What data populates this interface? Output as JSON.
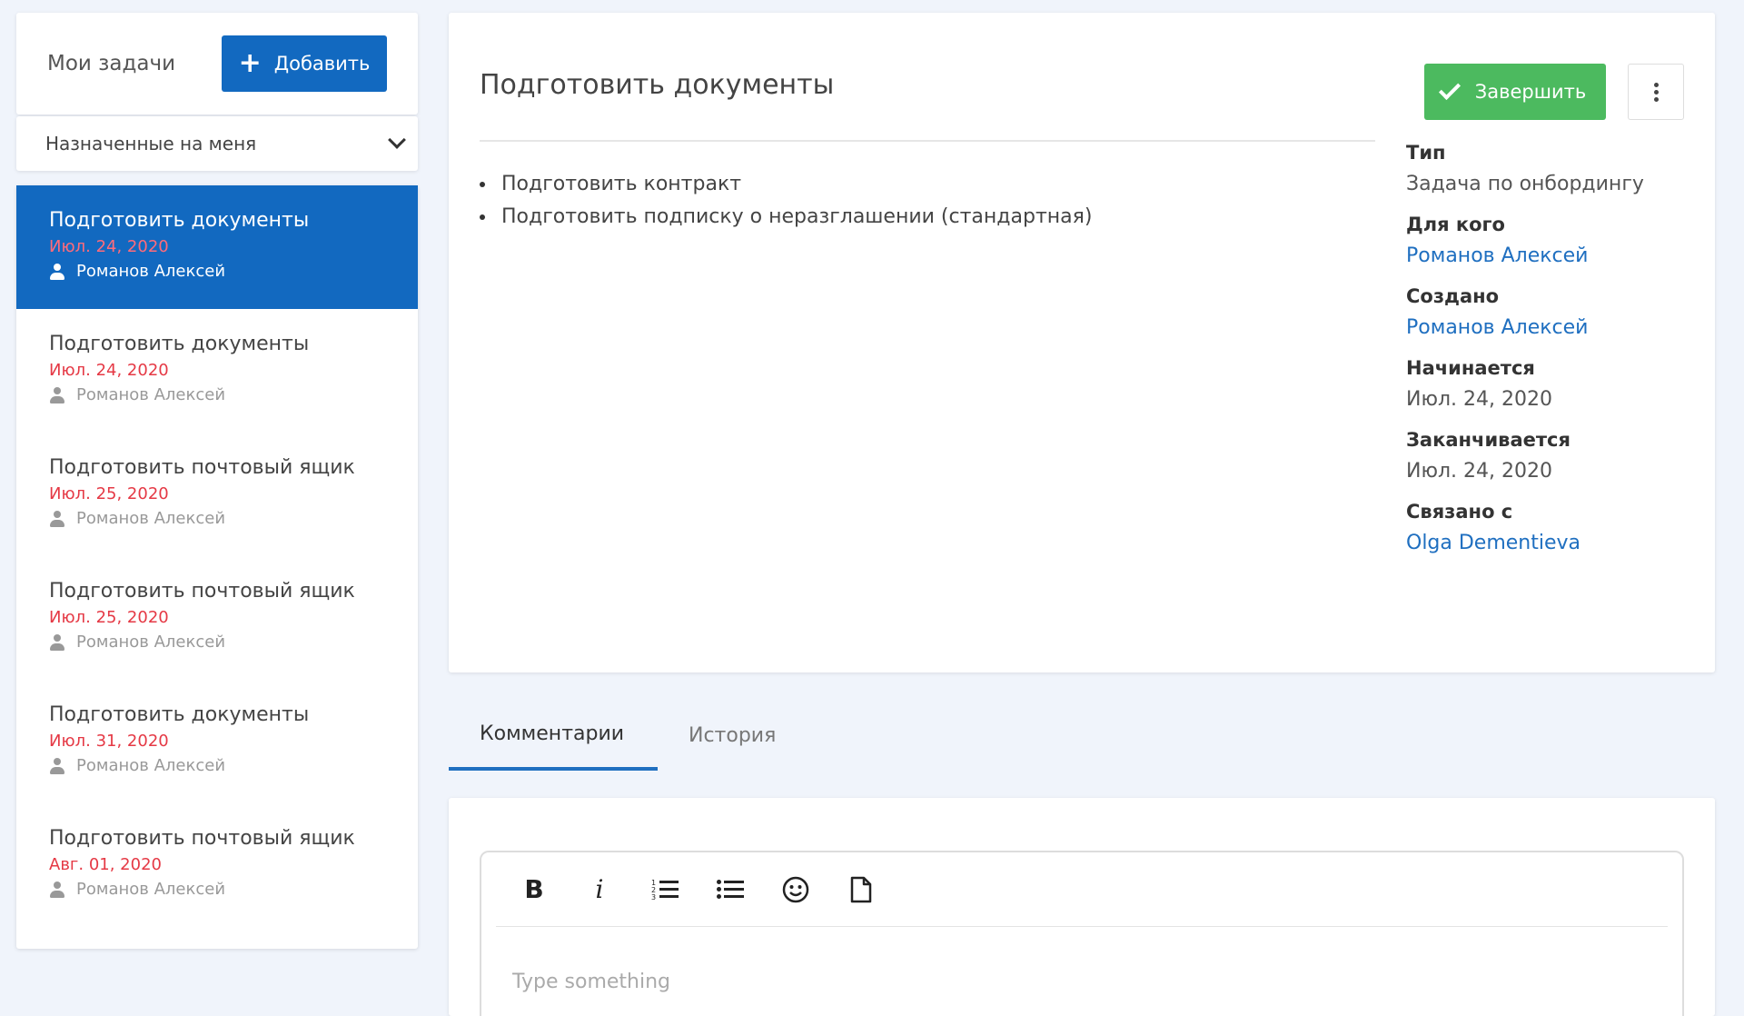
{
  "sidebar": {
    "title": "Мои задачи",
    "add_label": "Добавить",
    "filter_value": "Назначенные на меня",
    "tasks": [
      {
        "title": "Подготовить документы",
        "date": "Июл. 24, 2020",
        "user": "Романов Алексей",
        "active": true
      },
      {
        "title": "Подготовить документы",
        "date": "Июл. 24, 2020",
        "user": "Романов Алексей"
      },
      {
        "title": "Подготовить почтовый ящик",
        "date": "Июл. 25, 2020",
        "user": "Романов Алексей"
      },
      {
        "title": "Подготовить почтовый ящик",
        "date": "Июл. 25, 2020",
        "user": "Романов Алексей"
      },
      {
        "title": "Подготовить документы",
        "date": "Июл. 31, 2020",
        "user": "Романов Алексей"
      },
      {
        "title": "Подготовить почтовый ящик",
        "date": "Авг. 01, 2020",
        "user": "Романов Алексей"
      }
    ]
  },
  "detail": {
    "title": "Подготовить документы",
    "complete_label": "Завершить",
    "checklist": [
      "Подготовить контракт",
      "Подготовить подписку о неразглашении (стандартная)"
    ],
    "meta": [
      {
        "label": "Тип",
        "value": "Задача по онбордингу",
        "link": false
      },
      {
        "label": "Для кого",
        "value": "Романов Алексей",
        "link": true
      },
      {
        "label": "Создано",
        "value": "Романов Алексей",
        "link": true
      },
      {
        "label": "Начинается",
        "value": "Июл. 24, 2020",
        "link": false
      },
      {
        "label": "Заканчивается",
        "value": "Июл. 24, 2020",
        "link": false
      },
      {
        "label": "Связано с",
        "value": "Olga Dementieva",
        "link": true
      }
    ]
  },
  "tabs": [
    {
      "label": "Комментарии",
      "active": true
    },
    {
      "label": "История",
      "active": false
    }
  ],
  "editor": {
    "placeholder": "Type something",
    "tools": [
      "bold-icon",
      "italic-icon",
      "ordered-list-icon",
      "bullet-list-icon",
      "emoji-icon",
      "file-icon"
    ]
  },
  "colors": {
    "primary": "#1269c0",
    "success": "#4cba5f",
    "date_red": "#e53945",
    "link": "#1f6fc0",
    "background": "#f0f4fb"
  }
}
